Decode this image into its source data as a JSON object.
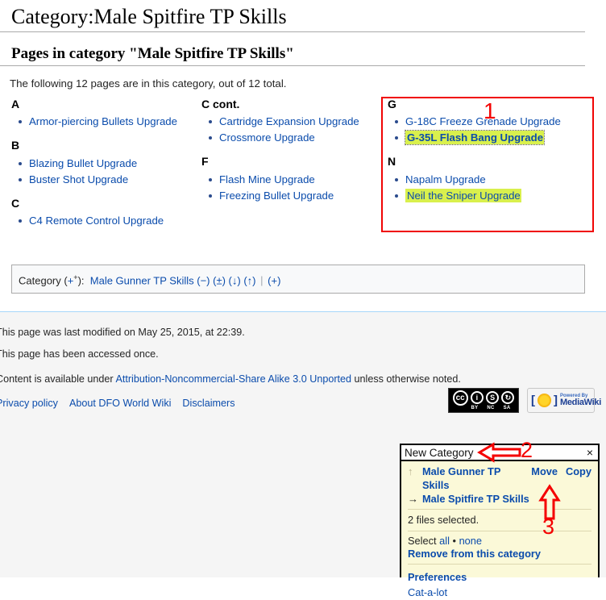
{
  "page": {
    "title": "Category:Male Spitfire TP Skills",
    "section_heading": "Pages in category \"Male Spitfire TP Skills\"",
    "intro": "The following 12 pages are in this category, out of 12 total."
  },
  "columns": [
    {
      "groups": [
        {
          "letter": "A",
          "items": [
            {
              "label": "Armor-piercing Bullets Upgrade",
              "highlight": "none"
            }
          ]
        },
        {
          "letter": "B",
          "items": [
            {
              "label": "Blazing Bullet Upgrade",
              "highlight": "none"
            },
            {
              "label": "Buster Shot Upgrade",
              "highlight": "none"
            }
          ]
        },
        {
          "letter": "C",
          "items": [
            {
              "label": "C4 Remote Control Upgrade",
              "highlight": "none"
            }
          ]
        }
      ]
    },
    {
      "groups": [
        {
          "letter": "C cont.",
          "items": [
            {
              "label": "Cartridge Expansion Upgrade",
              "highlight": "none"
            },
            {
              "label": "Crossmore Upgrade",
              "highlight": "none"
            }
          ]
        },
        {
          "letter": "F",
          "items": [
            {
              "label": "Flash Mine Upgrade",
              "highlight": "none"
            },
            {
              "label": "Freezing Bullet Upgrade",
              "highlight": "none"
            }
          ]
        }
      ]
    },
    {
      "groups": [
        {
          "letter": "G",
          "items": [
            {
              "label": "G-18C Freeze Grenade Upgrade",
              "highlight": "none"
            },
            {
              "label": "G-35L Flash Bang Upgrade",
              "highlight": "focus"
            }
          ]
        },
        {
          "letter": "N",
          "items": [
            {
              "label": "Napalm Upgrade",
              "highlight": "none"
            },
            {
              "label": "Neil the Sniper Upgrade",
              "highlight": "yes"
            }
          ]
        }
      ]
    }
  ],
  "catlinks": {
    "label": "Category",
    "plus_sup": "+",
    "plus_base": "+",
    "colon": ":",
    "category_name": "Male Gunner TP Skills",
    "ops": [
      "(−)",
      "(±)",
      "(↓)",
      "(↑)"
    ],
    "add": "(+)"
  },
  "footer": {
    "last_modified": "This page was last modified on May 25, 2015, at 22:39.",
    "accessed": "This page has been accessed once.",
    "license_pre": "Content is available under ",
    "license_link": "Attribution-Noncommercial-Share Alike 3.0 Unported",
    "license_post": " unless otherwise noted.",
    "links": [
      "Privacy policy",
      "About DFO World Wiki",
      "Disclaimers"
    ],
    "badges": {
      "cc": {
        "mark": "cc",
        "icons": [
          "i",
          "Ⓢ",
          "Ⓢ"
        ],
        "labels": [
          "BY",
          "NC",
          "SA"
        ]
      },
      "mediawiki": {
        "line1": "Powered By",
        "line2": "MediaWiki"
      }
    }
  },
  "catalot": {
    "input_value": "New Category",
    "input_placeholder": "New Category",
    "close_label": "×",
    "rows": [
      {
        "arrow": "↑",
        "arrow_kind": "up",
        "name": "Male Gunner TP Skills",
        "actions": [
          "Move",
          "Copy"
        ]
      },
      {
        "arrow": "→",
        "arrow_kind": "right",
        "name": "Male Spitfire TP Skills",
        "actions": []
      }
    ],
    "status": "2 files selected.",
    "select_label": "Select",
    "select_all": "all",
    "select_sep": "•",
    "select_none": "none",
    "remove_label": "Remove from this category",
    "preferences": "Preferences",
    "brand": "Cat-a-lot"
  },
  "annotations": {
    "one": "1",
    "two": "2",
    "three": "3",
    "color": "#f40000"
  }
}
